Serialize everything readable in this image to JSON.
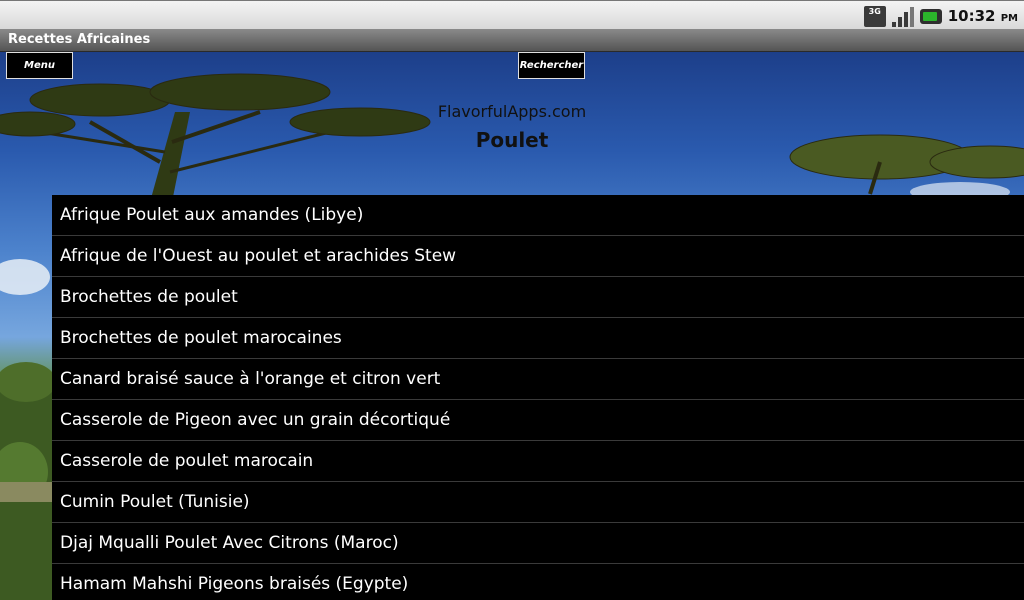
{
  "status_bar": {
    "network_label": "3G",
    "time": "10:32",
    "ampm": "PM"
  },
  "app": {
    "title": "Recettes Africaines"
  },
  "toolbar": {
    "menu_label": "Menu",
    "search_label": "Rechercher"
  },
  "header": {
    "site": "FlavorfulApps.com",
    "category": "Poulet"
  },
  "recipes": [
    "Afrique Poulet aux amandes (Libye)",
    "Afrique de l'Ouest au poulet et arachides Stew",
    "Brochettes de poulet",
    "Brochettes de poulet marocaines",
    "Canard braisé sauce à l'orange et citron vert",
    "Casserole de Pigeon avec un grain décortiqué",
    "Casserole de poulet marocain",
    "Cumin Poulet (Tunisie)",
    "Djaj Mqualli Poulet Avec Citrons (Maroc)",
    "Hamam Mahshi Pigeons braisés (Egypte)"
  ]
}
